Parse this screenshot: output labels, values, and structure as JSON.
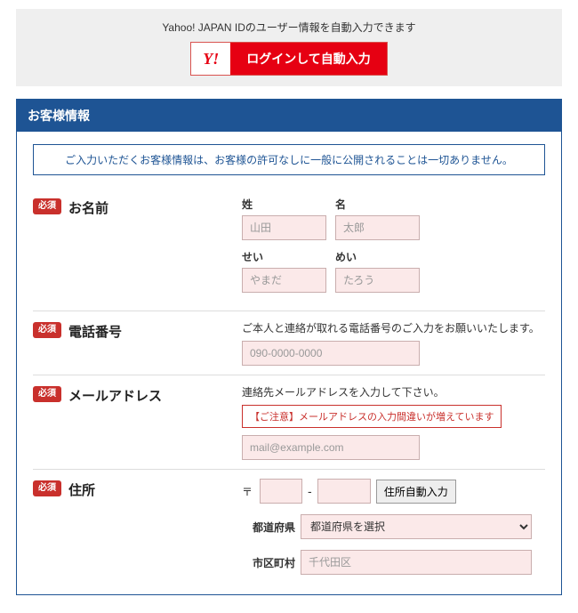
{
  "yahoo": {
    "note": "Yahoo! JAPAN IDのユーザー情報を自動入力できます",
    "logo": "Y!",
    "button": "ログインして自動入力"
  },
  "panel": {
    "title": "お客様情報",
    "notice": "ご入力いただくお客様情報は、お客様の許可なしに一般に公開されることは一切ありません。"
  },
  "badges": {
    "required": "必須"
  },
  "name": {
    "label": "お名前",
    "sei_label": "姓",
    "mei_label": "名",
    "sei_ph": "山田",
    "mei_ph": "太郎",
    "seikana_label": "せい",
    "meikana_label": "めい",
    "seikana_ph": "やまだ",
    "meikana_ph": "たろう"
  },
  "phone": {
    "label": "電話番号",
    "help": "ご本人と連絡が取れる電話番号のご入力をお願いいたします。",
    "ph": "090-0000-0000"
  },
  "mail": {
    "label": "メールアドレス",
    "help": "連絡先メールアドレスを入力して下さい。",
    "warn": "【ご注意】メールアドレスの入力間違いが増えています",
    "ph": "mail@example.com"
  },
  "address": {
    "label": "住所",
    "zip_mark": "〒",
    "dash": "-",
    "autofill": "住所自動入力",
    "pref_label": "都道府県",
    "pref_selected": "都道府県を選択",
    "city_label": "市区町村",
    "city_ph": "千代田区"
  }
}
